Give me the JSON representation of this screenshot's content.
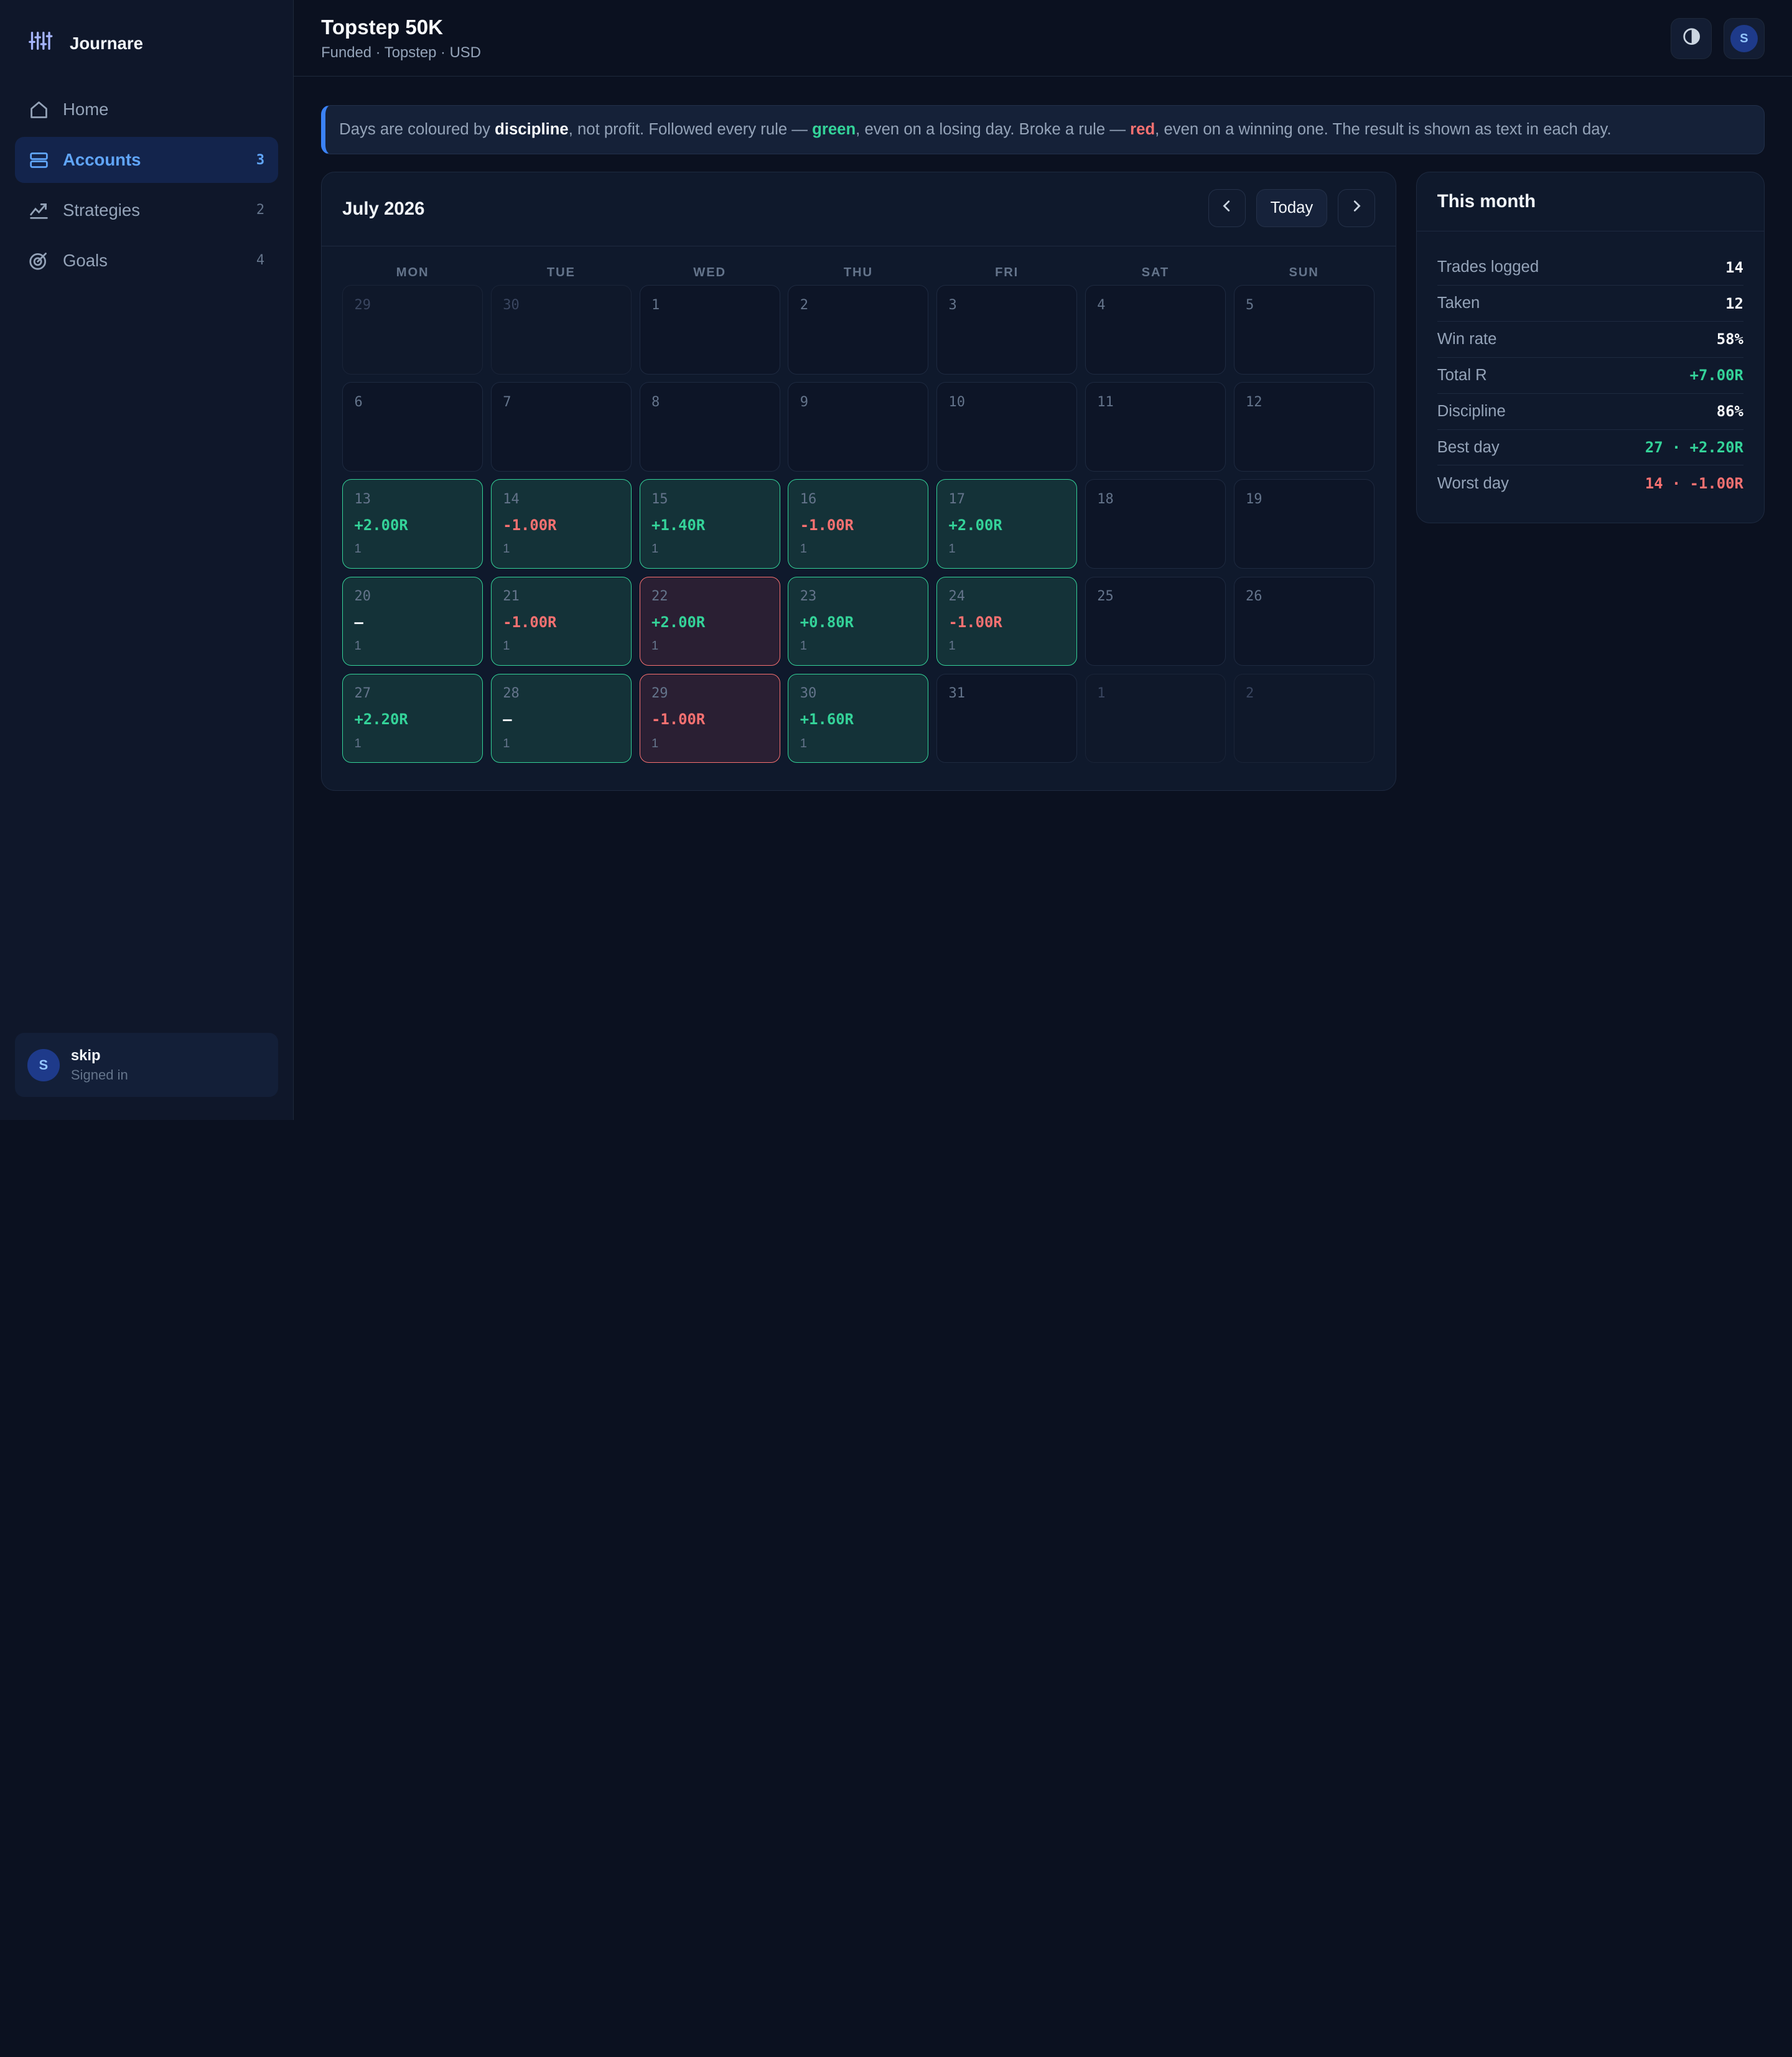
{
  "app": {
    "name": "Journare"
  },
  "nav": [
    {
      "key": "home",
      "label": "Home",
      "count": "",
      "active": false,
      "icon": "home-icon"
    },
    {
      "key": "accounts",
      "label": "Accounts",
      "count": "3",
      "active": true,
      "icon": "accounts-icon"
    },
    {
      "key": "strategies",
      "label": "Strategies",
      "count": "2",
      "active": false,
      "icon": "strategies-icon"
    },
    {
      "key": "goals",
      "label": "Goals",
      "count": "4",
      "active": false,
      "icon": "goals-icon"
    }
  ],
  "user": {
    "initial": "S",
    "name": "skip",
    "status": "Signed in"
  },
  "header": {
    "title": "Topstep 50K",
    "subtitle": "Funded · Topstep · USD",
    "avatar_initial": "S"
  },
  "banner": {
    "p1": "Days are coloured by ",
    "b1": "discipline",
    "p2": ", not profit. Followed every rule — ",
    "green": "green",
    "p3": ", even on a losing day. Broke a rule — ",
    "red": "red",
    "p4": ", even on a winning one. The result is shown as text in each day."
  },
  "calendar": {
    "month_label": "July 2026",
    "today_label": "Today",
    "weekdays": [
      "MON",
      "TUE",
      "WED",
      "THU",
      "FRI",
      "SAT",
      "SUN"
    ],
    "days": [
      {
        "d": "29",
        "out": true
      },
      {
        "d": "30",
        "out": true
      },
      {
        "d": "1"
      },
      {
        "d": "2"
      },
      {
        "d": "3"
      },
      {
        "d": "4"
      },
      {
        "d": "5"
      },
      {
        "d": "6"
      },
      {
        "d": "7"
      },
      {
        "d": "8"
      },
      {
        "d": "9"
      },
      {
        "d": "10"
      },
      {
        "d": "11"
      },
      {
        "d": "12"
      },
      {
        "d": "13",
        "status": "good",
        "result": "+2.00R",
        "sign": "pos",
        "trades": "1"
      },
      {
        "d": "14",
        "status": "good",
        "result": "-1.00R",
        "sign": "neg",
        "trades": "1"
      },
      {
        "d": "15",
        "status": "good",
        "result": "+1.40R",
        "sign": "pos",
        "trades": "1"
      },
      {
        "d": "16",
        "status": "good",
        "result": "-1.00R",
        "sign": "neg",
        "trades": "1"
      },
      {
        "d": "17",
        "status": "good",
        "result": "+2.00R",
        "sign": "pos",
        "trades": "1"
      },
      {
        "d": "18"
      },
      {
        "d": "19"
      },
      {
        "d": "20",
        "status": "good",
        "result": "—",
        "sign": "flat",
        "trades": "1"
      },
      {
        "d": "21",
        "status": "good",
        "result": "-1.00R",
        "sign": "neg",
        "trades": "1"
      },
      {
        "d": "22",
        "status": "bad",
        "result": "+2.00R",
        "sign": "pos",
        "trades": "1"
      },
      {
        "d": "23",
        "status": "good",
        "result": "+0.80R",
        "sign": "pos",
        "trades": "1"
      },
      {
        "d": "24",
        "status": "good",
        "result": "-1.00R",
        "sign": "neg",
        "trades": "1"
      },
      {
        "d": "25"
      },
      {
        "d": "26"
      },
      {
        "d": "27",
        "status": "good",
        "result": "+2.20R",
        "sign": "pos",
        "trades": "1"
      },
      {
        "d": "28",
        "status": "good",
        "result": "—",
        "sign": "flat",
        "trades": "1"
      },
      {
        "d": "29",
        "status": "bad",
        "result": "-1.00R",
        "sign": "neg",
        "trades": "1"
      },
      {
        "d": "30",
        "status": "good",
        "result": "+1.60R",
        "sign": "pos",
        "trades": "1"
      },
      {
        "d": "31"
      },
      {
        "d": "1",
        "out": true
      },
      {
        "d": "2",
        "out": true
      }
    ]
  },
  "stats": {
    "title": "This month",
    "rows": [
      {
        "label": "Trades logged",
        "value": "14",
        "tone": ""
      },
      {
        "label": "Taken",
        "value": "12",
        "tone": ""
      },
      {
        "label": "Win rate",
        "value": "58%",
        "tone": ""
      },
      {
        "label": "Total R",
        "value": "+7.00R",
        "tone": "pos"
      },
      {
        "label": "Discipline",
        "value": "86%",
        "tone": ""
      },
      {
        "label": "Best day",
        "value": "27 · +2.20R",
        "tone": "pos"
      },
      {
        "label": "Worst day",
        "value": "14 · -1.00R",
        "tone": "neg"
      }
    ]
  },
  "colors": {
    "accent": "#3b82f6",
    "good": "#34d399",
    "bad": "#f87171",
    "background": "#0b1120"
  }
}
